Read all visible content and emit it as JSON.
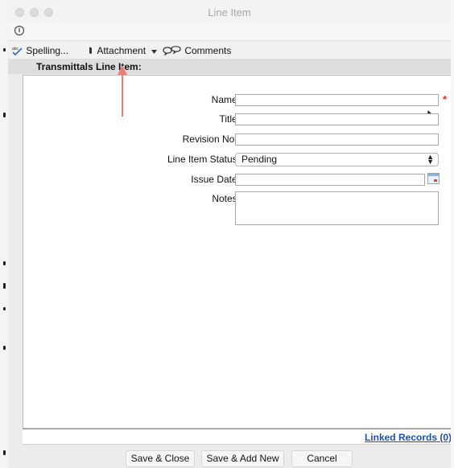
{
  "window": {
    "title": "Line Item"
  },
  "toolbar": {
    "spelling_label": "Spelling...",
    "attachment_label": "Attachment",
    "comments_label": "Comments"
  },
  "section": {
    "title": "Transmittals Line Item:"
  },
  "form": {
    "name_label": "Name:",
    "name_value": "",
    "title_label": "Title:",
    "title_value": "",
    "revision_label": "Revision No.:",
    "revision_value": "",
    "status_label": "Line Item Status:",
    "status_value": "Pending",
    "issue_date_label": "Issue Date:",
    "issue_date_value": "",
    "notes_label": "Notes:",
    "notes_value": "",
    "required_marker": "*"
  },
  "footer": {
    "linked_records_label": "Linked Records (0)"
  },
  "buttons": {
    "save_close": "Save & Close",
    "save_add_new": "Save & Add New",
    "cancel": "Cancel"
  },
  "colors": {
    "required": "#e0301e",
    "link": "#1e4fb0",
    "annotation_arrow": "#e57f7a"
  }
}
